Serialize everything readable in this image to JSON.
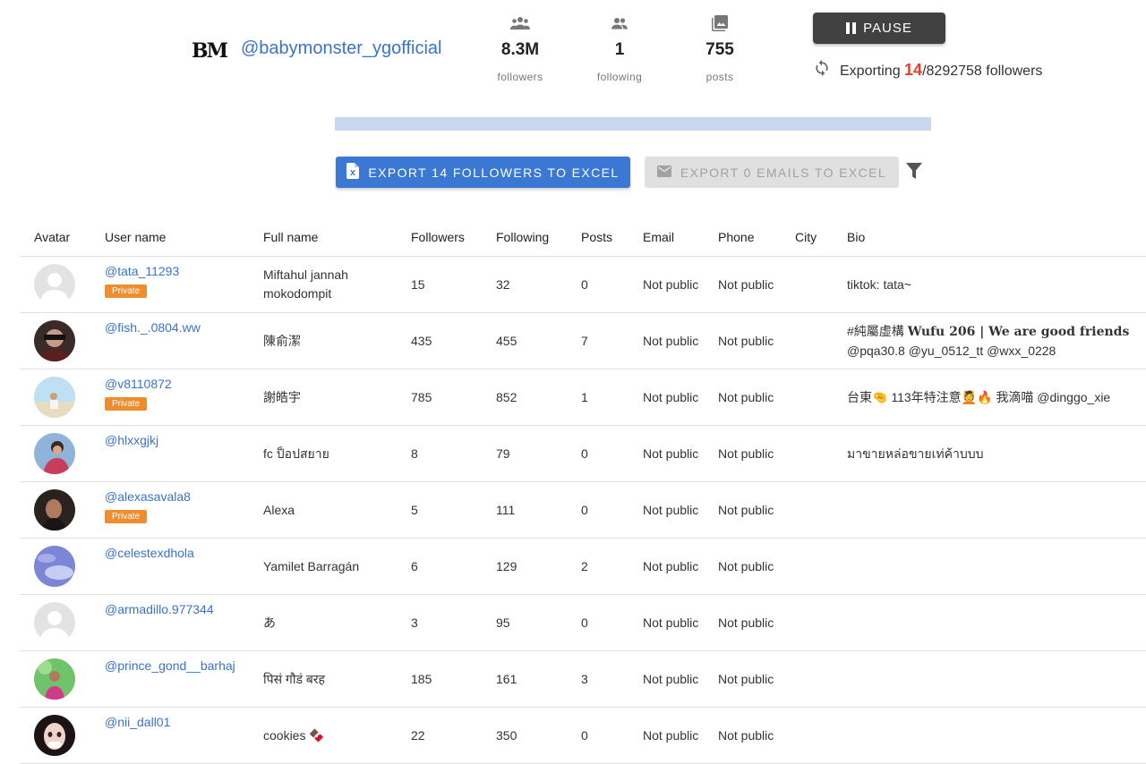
{
  "profile": {
    "logo_text": "BM",
    "handle": "@babymonster_ygofficial",
    "stats": [
      {
        "icon": "people-group-icon",
        "value": "8.3M",
        "label": "followers"
      },
      {
        "icon": "people-icon",
        "value": "1",
        "label": "following"
      },
      {
        "icon": "image-icon",
        "value": "755",
        "label": "posts"
      }
    ]
  },
  "controls": {
    "pause_label": "PAUSE",
    "export_prefix": "Exporting",
    "export_current": "14",
    "export_total": "/8292758",
    "export_suffix": "followers",
    "progress_fraction": 1.7e-06,
    "export_followers_label": "EXPORT 14 FOLLOWERS TO EXCEL",
    "export_emails_label": "EXPORT 0 EMAILS TO EXCEL"
  },
  "colors": {
    "accent": "#3b78d3",
    "badge": "#ef8d2c",
    "highlight": "#e0402a"
  },
  "table": {
    "headers": [
      "Avatar",
      "User name",
      "Full name",
      "Followers",
      "Following",
      "Posts",
      "Email",
      "Phone",
      "City",
      "Bio"
    ],
    "rows": [
      {
        "avatar": "placeholder",
        "username": "@tata_11293",
        "private": true,
        "fullname": "Miftahul jannah mokodompit",
        "followers": "15",
        "following": "32",
        "posts": "0",
        "email": "Not public",
        "phone": "Not public",
        "city": "",
        "bio": "tiktok: tata~"
      },
      {
        "avatar": "photo-dark",
        "username": "@fish._.0804.ww",
        "private": false,
        "fullname": "陳俞潔",
        "followers": "435",
        "following": "455",
        "posts": "7",
        "email": "Not public",
        "phone": "Not public",
        "city": "",
        "bio_line1_prefix": "#純屬虛構 ",
        "bio_line1_styled": "Wufu 206 | We are good friends",
        "bio_line2": "@pqa30.8 @yu_0512_tt @wxx_0228"
      },
      {
        "avatar": "photo-beach",
        "username": "@v8110872",
        "private": true,
        "fullname": "謝皓宇",
        "followers": "785",
        "following": "852",
        "posts": "1",
        "email": "Not public",
        "phone": "Not public",
        "city": "",
        "bio": "台東🤏 113年特注意💆🔥 我滴喵 @dinggo_xie"
      },
      {
        "avatar": "photo-sky",
        "username": "@hlxxgjkj",
        "private": false,
        "fullname": "fc ป็อปสยาย",
        "followers": "8",
        "following": "79",
        "posts": "0",
        "email": "Not public",
        "phone": "Not public",
        "city": "",
        "bio": "มาขายหล่อขายเท่ค้าบบบ"
      },
      {
        "avatar": "photo-portrait",
        "username": "@alexasavala8",
        "private": true,
        "fullname": "Alexa",
        "followers": "5",
        "following": "111",
        "posts": "0",
        "email": "Not public",
        "phone": "Not public",
        "city": "",
        "bio": ""
      },
      {
        "avatar": "photo-cloud",
        "username": "@celestexdhola",
        "private": false,
        "fullname": "Yamilet Barragán",
        "followers": "6",
        "following": "129",
        "posts": "2",
        "email": "Not public",
        "phone": "Not public",
        "city": "",
        "bio": ""
      },
      {
        "avatar": "placeholder",
        "username": "@armadillo.977344",
        "private": false,
        "fullname": "あ",
        "followers": "3",
        "following": "95",
        "posts": "0",
        "email": "Not public",
        "phone": "Not public",
        "city": "",
        "bio": ""
      },
      {
        "avatar": "photo-green",
        "username": "@prince_gond__barhaj",
        "private": false,
        "fullname": "पिसं गौडं बरह",
        "followers": "185",
        "following": "161",
        "posts": "3",
        "email": "Not public",
        "phone": "Not public",
        "city": "",
        "bio": ""
      },
      {
        "avatar": "photo-doll",
        "username": "@nii_dall01",
        "private": false,
        "fullname": "cookies 🍫",
        "followers": "22",
        "following": "350",
        "posts": "0",
        "email": "Not public",
        "phone": "Not public",
        "city": "",
        "bio": ""
      }
    ],
    "private_label": "Private"
  }
}
